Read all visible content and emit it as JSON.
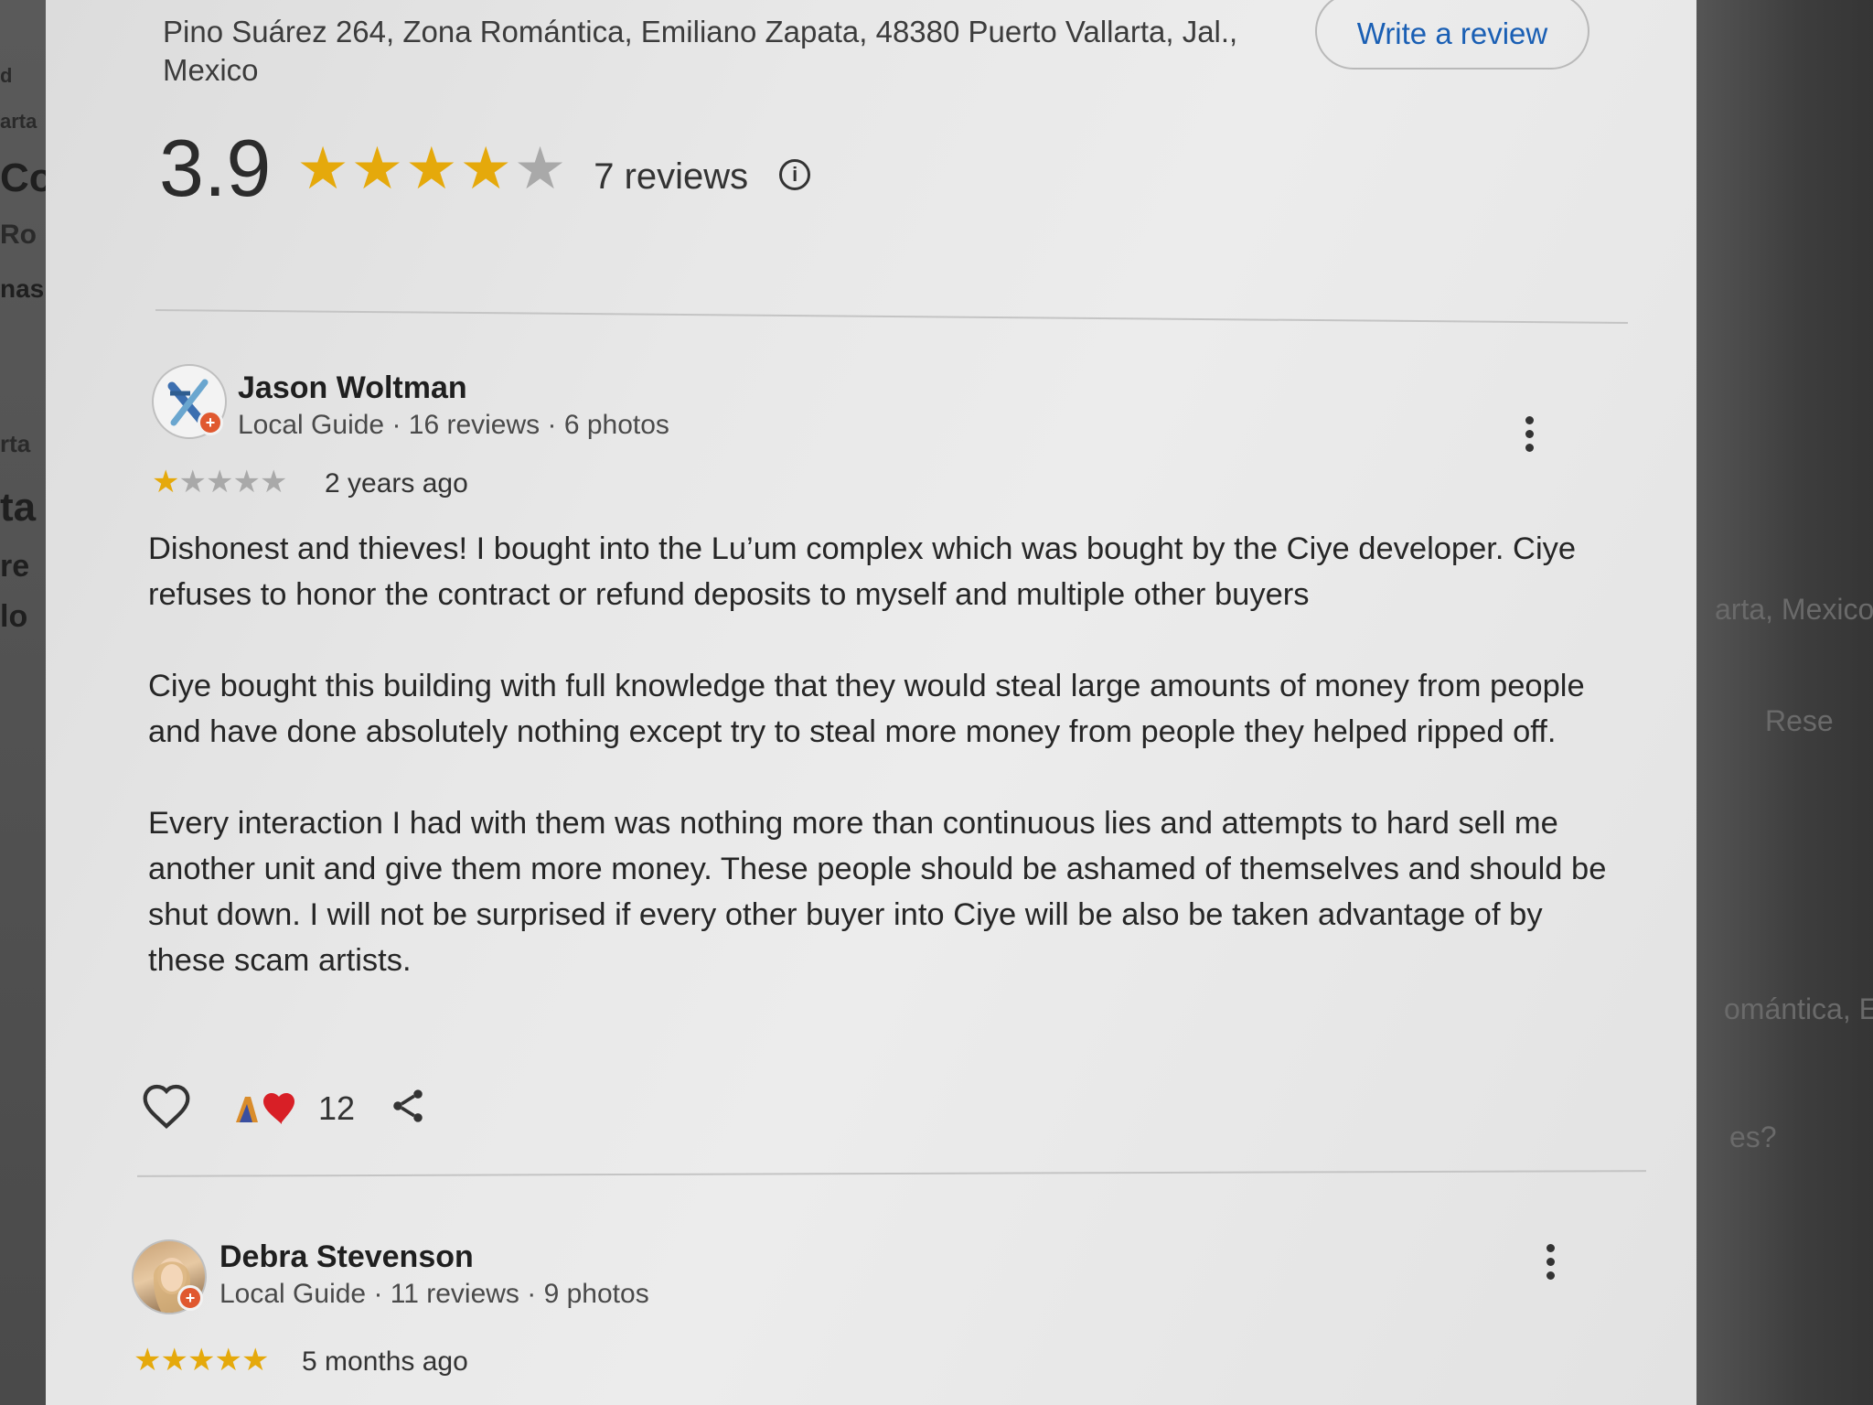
{
  "place": {
    "address": "Pino Suárez 264, Zona Romántica, Emiliano Zapata, 48380 Puerto Vallarta, Jal., Mexico",
    "write_review_label": "Write a review",
    "rating": "3.9",
    "rating_stars": 3.9,
    "reviews_count_label": "7 reviews",
    "info_icon": "info-icon"
  },
  "reviews": [
    {
      "name": "Jason Woltman",
      "meta": "Local Guide · 16 reviews · 6 photos",
      "stars": 1,
      "time": "2 years ago",
      "paragraphs": [
        "Dishonest and thieves! I bought into the Lu’um complex which was bought by the Ciye developer. Ciye refuses to honor the contract or refund deposits to myself and multiple other buyers",
        "Ciye bought this building with full knowledge that they would steal large amounts of money from people and have done absolutely nothing except try to steal more money from people they helped ripped off.",
        "Every interaction I had with them was nothing more than continuous lies and attempts to hard sell me another unit and give them more money. These people should be ashamed of themselves and should be shut down. I will not be surprised if every other buyer into Ciye will be also be taken advantage of by these scam artists."
      ],
      "reaction_count": "12",
      "icons": [
        "heart-outline-icon",
        "reaction-emoji-icon",
        "share-icon",
        "more-vert-icon"
      ]
    },
    {
      "name": "Debra Stevenson",
      "meta": "Local Guide · 11 reviews · 9 photos",
      "stars": 5,
      "time": "5 months ago"
    }
  ],
  "background": {
    "left_fragments": [
      "d",
      "arta",
      "Co",
      "Ro",
      "nas",
      "rta",
      "ta",
      "re",
      "lo"
    ],
    "right_fragments": [
      "arta, Mexico",
      "Rese",
      "omántica, E",
      "es?"
    ]
  },
  "colors": {
    "star": "#e5a90b",
    "star_empty": "#a9a9a9",
    "link": "#1a5fb4",
    "badge": "#e0582f"
  }
}
